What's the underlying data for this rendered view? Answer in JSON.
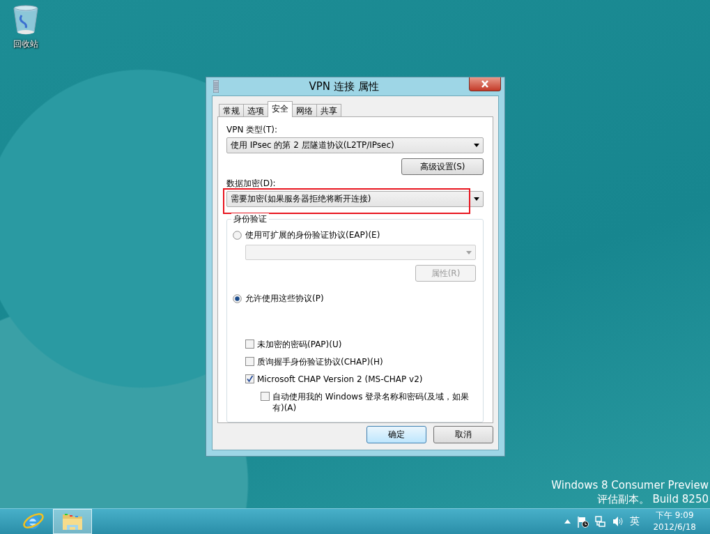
{
  "desktop_icons": [
    {
      "label": "回收站"
    }
  ],
  "dialog": {
    "title": "VPN 连接 属性",
    "tabs": [
      {
        "label": "常规",
        "selected": false
      },
      {
        "label": "选项",
        "selected": false
      },
      {
        "label": "安全",
        "selected": true
      },
      {
        "label": "网络",
        "selected": false
      },
      {
        "label": "共享",
        "selected": false
      }
    ],
    "vpn_type": {
      "label": "VPN 类型(T):",
      "value": "使用 IPsec 的第 2 层隧道协议(L2TP/IPsec)"
    },
    "advanced_button": {
      "label": "高级设置(S)"
    },
    "encryption": {
      "label": "数据加密(D):",
      "value": "需要加密(如果服务器拒绝将断开连接)",
      "highlighted": true
    },
    "authentication": {
      "title": "身份验证",
      "options": [
        {
          "label": "使用可扩展的身份验证协议(EAP)(E)",
          "selected": false
        },
        {
          "label": "允许使用这些协议(P)",
          "selected": true
        }
      ],
      "eap_select": {
        "disabled": true
      },
      "properties_button": {
        "label": "属性(R)",
        "disabled": true
      },
      "protocols": [
        {
          "label": "未加密的密码(PAP)(U)",
          "checked": false
        },
        {
          "label": "质询握手身份验证协议(CHAP)(H)",
          "checked": false
        },
        {
          "label": "Microsoft CHAP Version 2 (MS-CHAP v2)",
          "checked": true,
          "children": [
            {
              "label": "自动使用我的 Windows 登录名称和密码(及域，如果有)(A)",
              "checked": false
            }
          ]
        }
      ]
    },
    "buttons": [
      {
        "label": "确定",
        "default": true
      },
      {
        "label": "取消",
        "default": false
      }
    ]
  },
  "edition": [
    "Windows 8 Consumer Preview",
    "评估副本。 Build 8250"
  ],
  "taskbar": {
    "apps": [
      {
        "kind": "browser",
        "selected": false
      },
      {
        "kind": "folder",
        "selected": true
      }
    ],
    "tray": {
      "language": "英",
      "time": "下午 9:09",
      "date": "2012/6/18"
    }
  }
}
